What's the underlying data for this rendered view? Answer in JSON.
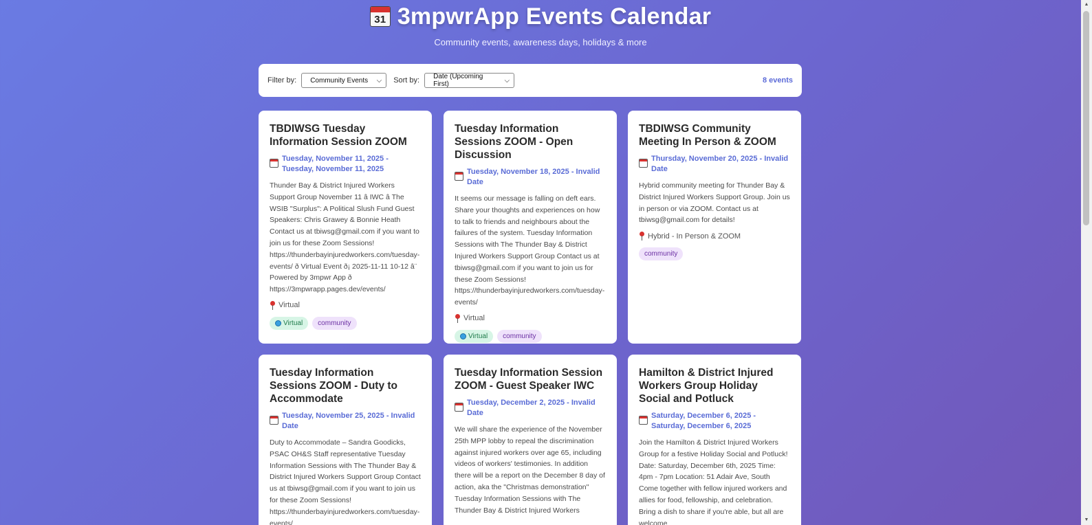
{
  "header": {
    "title": "3mpwrApp Events Calendar",
    "title_icon": "calendar-icon",
    "title_icon_day": "31",
    "subtitle": "Community events, awareness days, holidays & more"
  },
  "toolbar": {
    "filter_label": "Filter by:",
    "filter_value": "Community Events",
    "sort_label": "Sort by:",
    "sort_value": "Date (Upcoming First)",
    "event_count": "8 events"
  },
  "colors": {
    "accent": "#5a6cd6",
    "virtual_tag_bg": "#d7f5e6",
    "community_tag_bg": "#efe2fb"
  },
  "events": [
    {
      "title": "TBDIWSG Tuesday Information Session ZOOM",
      "date": "Tuesday, November 11, 2025 - Tuesday, November 11, 2025",
      "description": "Thunder Bay & District Injured Workers Support Group November 11 â IWC â The WSIB \"Surplus\": A Political Slush Fund Guest Speakers: Chris Grawey & Bonnie Heath Contact us at tbiwsg@gmail.com if you want to join us for these Zoom Sessions! https://thunderbayinjuredworkers.com/tuesday-events/ ð Virtual Event ð¡ 2025-11-11 10-12 â¨ Powered by 3mpwr App ð https://3mpwrapp.pages.dev/events/",
      "location": "Virtual",
      "tags": [
        "Virtual",
        "community"
      ]
    },
    {
      "title": "Tuesday Information Sessions ZOOM - Open Discussion",
      "date": "Tuesday, November 18, 2025 - Invalid Date",
      "description": "It seems our message is falling on deft ears. Share your thoughts and experiences on how to talk to friends and neighbours about the failures of the system. Tuesday Information Sessions with The Thunder Bay & District Injured Workers Support Group Contact us at tbiwsg@gmail.com if you want to join us for these Zoom Sessions! https://thunderbayinjuredworkers.com/tuesday-events/",
      "location": "Virtual",
      "tags": [
        "Virtual",
        "community"
      ]
    },
    {
      "title": "TBDIWSG Community Meeting In Person & ZOOM",
      "date": "Thursday, November 20, 2025 - Invalid Date",
      "description": "Hybrid community meeting for Thunder Bay & District Injured Workers Support Group. Join us in person or via ZOOM. Contact us at tbiwsg@gmail.com for details!",
      "location": "Hybrid - In Person & ZOOM",
      "tags": [
        "community"
      ]
    },
    {
      "title": "Tuesday Information Sessions ZOOM - Duty to Accommodate",
      "date": "Tuesday, November 25, 2025 - Invalid Date",
      "description": "Duty to Accommodate – Sandra Goodicks, PSAC OH&S Staff representative Tuesday Information Sessions with The Thunder Bay & District Injured Workers Support Group Contact us at tbiwsg@gmail.com if you want to join us for these Zoom Sessions! https://thunderbayinjuredworkers.com/tuesday-events/",
      "location": "",
      "tags": []
    },
    {
      "title": "Tuesday Information Session ZOOM - Guest Speaker IWC",
      "date": "Tuesday, December 2, 2025 - Invalid Date",
      "description": "We will share the experience of the November 25th MPP lobby to repeal the discrimination against injured workers over age 65, including videos of workers' testimonies. In addition there will be a report on the December 8 day of action, aka the \"Christmas demonstration\" Tuesday Information Sessions with The Thunder Bay & District Injured Workers",
      "location": "",
      "tags": []
    },
    {
      "title": "Hamilton & District Injured Workers Group Holiday Social and Potluck",
      "date": "Saturday, December 6, 2025 - Saturday, December 6, 2025",
      "description": "Join the Hamilton & District Injured Workers Group for a festive Holiday Social and Potluck! Date: Saturday, December 6th, 2025 Time: 4pm - 7pm Location: 51 Adair Ave, South Come together with fellow injured workers and allies for food, fellowship, and celebration. Bring a dish to share if you're able, but all are welcome",
      "location": "",
      "tags": []
    }
  ]
}
